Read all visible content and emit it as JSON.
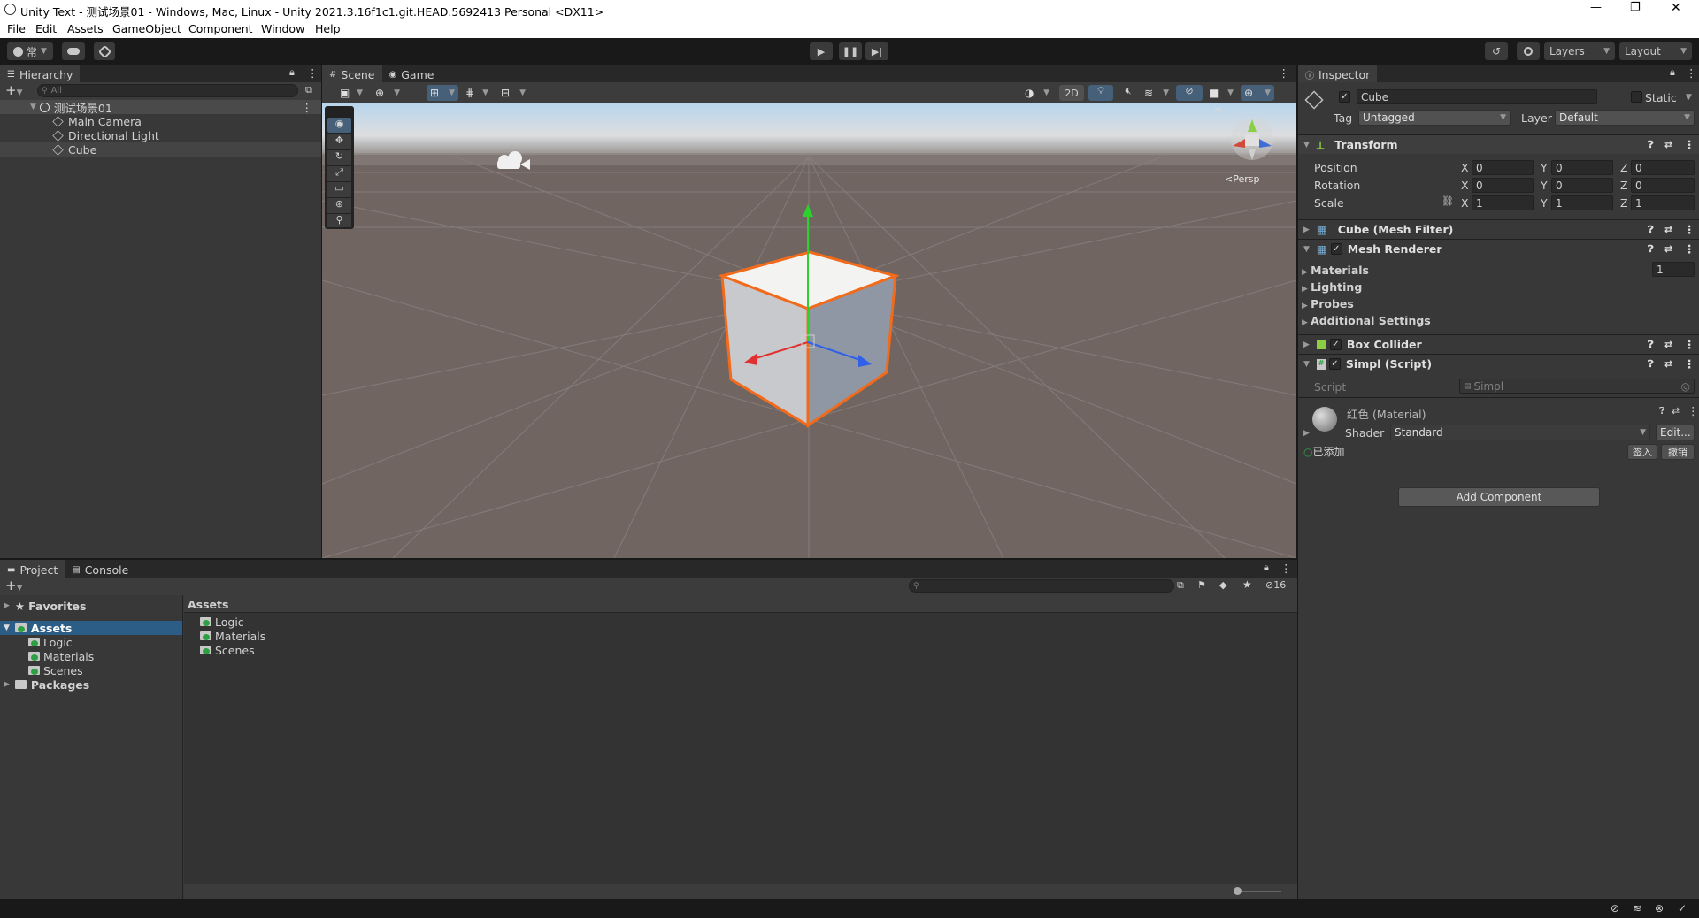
{
  "window": {
    "title": "Unity Text - 测试场景01 - Windows, Mac, Linux - Unity 2021.3.16f1c1.git.HEAD.5692413 Personal <DX11>",
    "controls": [
      "—",
      "❐",
      "✕"
    ]
  },
  "menu": [
    "File",
    "Edit",
    "Assets",
    "GameObject",
    "Component",
    "Window",
    "Help"
  ],
  "toolbar": {
    "account": "常",
    "layers": "Layers",
    "layout": "Layout"
  },
  "hierarchy": {
    "title": "Hierarchy",
    "search_placeholder": "All",
    "scene": "测试场景01",
    "items": [
      "Main Camera",
      "Directional Light",
      "Cube"
    ]
  },
  "scene_view": {
    "tabs": [
      "Scene",
      "Game"
    ],
    "mode_2d": "2D",
    "persp": "Persp"
  },
  "inspector": {
    "title": "Inspector",
    "object_name": "Cube",
    "static_label": "Static",
    "tag_label": "Tag",
    "tag_value": "Untagged",
    "layer_label": "Layer",
    "layer_value": "Default",
    "transform": {
      "title": "Transform",
      "rows": [
        {
          "label": "Position",
          "x": "0",
          "y": "0",
          "z": "0"
        },
        {
          "label": "Rotation",
          "x": "0",
          "y": "0",
          "z": "0"
        },
        {
          "label": "Scale",
          "x": "1",
          "y": "1",
          "z": "1"
        }
      ]
    },
    "mesh_filter": "Cube (Mesh Filter)",
    "mesh_renderer": {
      "title": "Mesh Renderer",
      "sections": [
        "Materials",
        "Lighting",
        "Probes",
        "Additional Settings"
      ],
      "materials_count": "1"
    },
    "box_collider": "Box Collider",
    "script_component": {
      "title": "Simpl (Script)",
      "script_label": "Script",
      "script_value": "Simpl"
    },
    "material": {
      "name": "红色 (Material)",
      "shader_label": "Shader",
      "shader_value": "Standard",
      "edit": "Edit...",
      "added": "已添加",
      "sign_in": "签入",
      "revert": "撤销"
    },
    "add_component": "Add Component"
  },
  "project": {
    "tabs": [
      "Project",
      "Console"
    ],
    "favorites": "Favorites",
    "assets": "Assets",
    "asset_folders": [
      "Logic",
      "Materials",
      "Scenes"
    ],
    "packages": "Packages",
    "breadcrumb": "Assets",
    "hidden_count": "16"
  }
}
